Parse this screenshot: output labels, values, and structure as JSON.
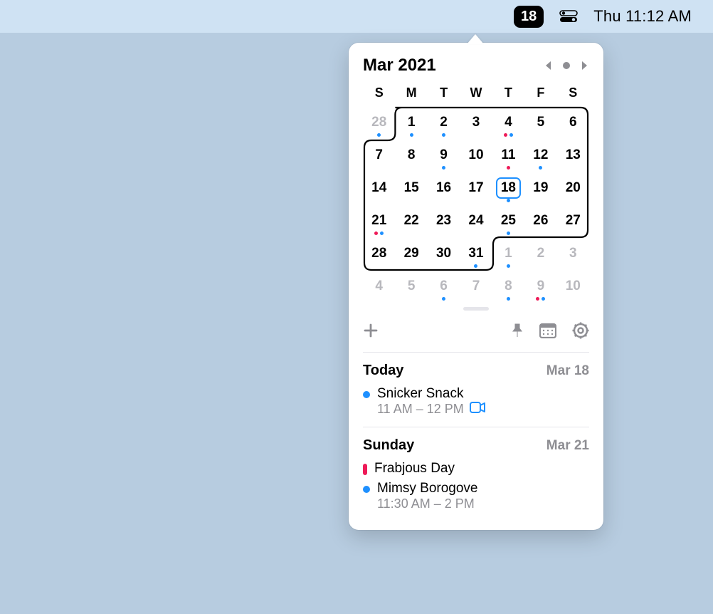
{
  "menubar": {
    "date_badge": "18",
    "clock": "Thu 11:12 AM"
  },
  "calendar": {
    "title": "Mar 2021",
    "weekdays": [
      "S",
      "M",
      "T",
      "W",
      "T",
      "F",
      "S"
    ],
    "days": [
      {
        "n": "28",
        "dim": true,
        "dots": [
          "blue"
        ]
      },
      {
        "n": "1",
        "dots": [
          "blue"
        ]
      },
      {
        "n": "2",
        "dots": [
          "blue"
        ]
      },
      {
        "n": "3"
      },
      {
        "n": "4",
        "dots": [
          "red",
          "blue"
        ]
      },
      {
        "n": "5"
      },
      {
        "n": "6"
      },
      {
        "n": "7"
      },
      {
        "n": "8"
      },
      {
        "n": "9",
        "dots": [
          "blue"
        ]
      },
      {
        "n": "10"
      },
      {
        "n": "11",
        "dots": [
          "red"
        ]
      },
      {
        "n": "12",
        "dots": [
          "blue"
        ]
      },
      {
        "n": "13"
      },
      {
        "n": "14"
      },
      {
        "n": "15"
      },
      {
        "n": "16"
      },
      {
        "n": "17"
      },
      {
        "n": "18",
        "today": true,
        "dots": [
          "blue"
        ]
      },
      {
        "n": "19"
      },
      {
        "n": "20"
      },
      {
        "n": "21",
        "dots": [
          "red",
          "blue"
        ]
      },
      {
        "n": "22"
      },
      {
        "n": "23"
      },
      {
        "n": "24"
      },
      {
        "n": "25",
        "dots": [
          "blue"
        ]
      },
      {
        "n": "26"
      },
      {
        "n": "27"
      },
      {
        "n": "28"
      },
      {
        "n": "29"
      },
      {
        "n": "30"
      },
      {
        "n": "31",
        "dots": [
          "blue"
        ]
      },
      {
        "n": "1",
        "dim": true,
        "dots": [
          "blue"
        ]
      },
      {
        "n": "2",
        "dim": true
      },
      {
        "n": "3",
        "dim": true
      },
      {
        "n": "4",
        "dim": true
      },
      {
        "n": "5",
        "dim": true
      },
      {
        "n": "6",
        "dim": true,
        "dots": [
          "blue"
        ]
      },
      {
        "n": "7",
        "dim": true
      },
      {
        "n": "8",
        "dim": true,
        "dots": [
          "blue"
        ]
      },
      {
        "n": "9",
        "dim": true,
        "dots": [
          "red",
          "blue"
        ]
      },
      {
        "n": "10",
        "dim": true
      }
    ]
  },
  "sections": [
    {
      "title": "Today",
      "date": "Mar 18",
      "events": [
        {
          "marker": "dot",
          "color": "blue",
          "title": "Snicker Snack",
          "time": "11 AM – 12 PM",
          "video": true
        }
      ]
    },
    {
      "title": "Sunday",
      "date": "Mar 21",
      "events": [
        {
          "marker": "pill",
          "color": "red",
          "title": "Frabjous Day"
        },
        {
          "marker": "dot",
          "color": "blue",
          "title": "Mimsy Borogove",
          "time": "11:30 AM – 2 PM"
        }
      ]
    }
  ]
}
